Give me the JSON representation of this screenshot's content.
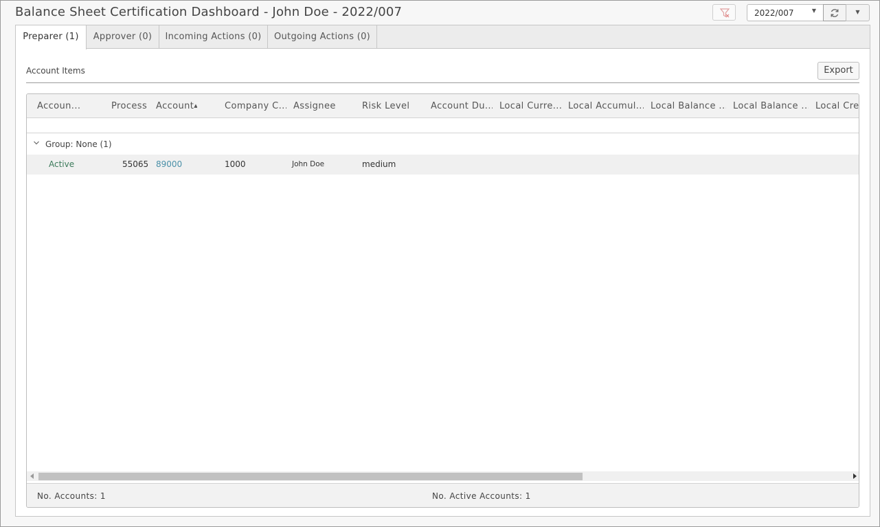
{
  "header": {
    "title": "Balance Sheet Certification Dashboard - John Doe - 2022/007",
    "period_value": "2022/007",
    "icons": {
      "filter": "filter-clear-icon",
      "refresh": "refresh-icon",
      "dropdown": "caret-down-icon"
    }
  },
  "tabs": [
    {
      "label": "Preparer (1)",
      "active": true
    },
    {
      "label": "Approver (0)",
      "active": false
    },
    {
      "label": "Incoming Actions (0)",
      "active": false
    },
    {
      "label": "Outgoing Actions (0)",
      "active": false
    }
  ],
  "section": {
    "label": "Account Items",
    "export_label": "Export"
  },
  "grid": {
    "columns": [
      "Accoun...",
      "Process",
      "Account",
      "Company C...",
      "Assignee",
      "Risk Level",
      "Account Du...",
      "Local Curre...",
      "Local Accumul...",
      "Local Balance ...",
      "Local Balance ...",
      "Local Cred"
    ],
    "sort_indicator": "▲",
    "group_label": "Group: None (1)",
    "rows": [
      {
        "status": "Active",
        "process": "55065",
        "account": "89000",
        "company": "1000",
        "assignee": "John Doe",
        "risk": "medium"
      }
    ]
  },
  "footer": {
    "accounts_label": "No. Accounts:  1",
    "active_accounts_label": "No. Active Accounts:  1"
  },
  "colors": {
    "accent_link": "#4a90a8",
    "status_green": "#3b7a5a",
    "border": "#c6c6c6"
  }
}
